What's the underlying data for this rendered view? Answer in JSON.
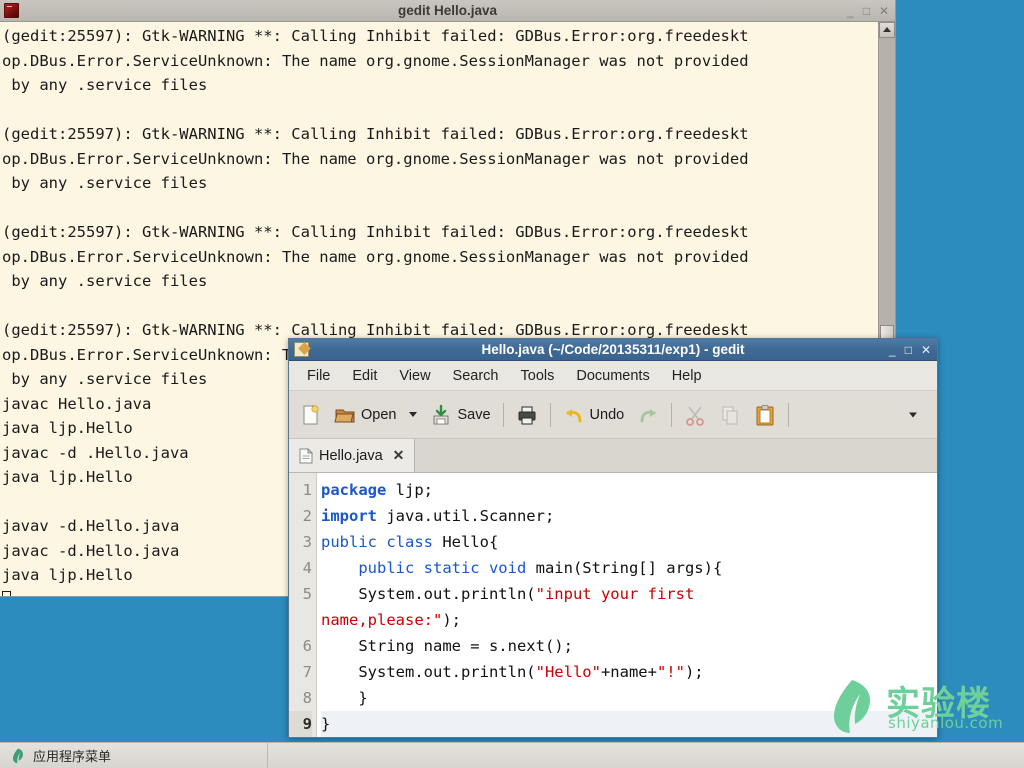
{
  "desktop": {
    "background_color": "#2c8cbd"
  },
  "terminal": {
    "title": "gedit Hello.java",
    "icon": "terminal-icon",
    "window_buttons": [
      {
        "name": "minimize-button",
        "glyph": "_"
      },
      {
        "name": "maximize-button",
        "glyph": "□"
      },
      {
        "name": "close-button",
        "glyph": "✕"
      }
    ],
    "background_color": "#fdf6e3",
    "lines": [
      "(gedit:25597): Gtk-WARNING **: Calling Inhibit failed: GDBus.Error:org.freedeskt",
      "op.DBus.Error.ServiceUnknown: The name org.gnome.SessionManager was not provided",
      " by any .service files",
      "",
      "(gedit:25597): Gtk-WARNING **: Calling Inhibit failed: GDBus.Error:org.freedeskt",
      "op.DBus.Error.ServiceUnknown: The name org.gnome.SessionManager was not provided",
      " by any .service files",
      "",
      "(gedit:25597): Gtk-WARNING **: Calling Inhibit failed: GDBus.Error:org.freedeskt",
      "op.DBus.Error.ServiceUnknown: The name org.gnome.SessionManager was not provided",
      " by any .service files",
      "",
      "(gedit:25597): Gtk-WARNING **: Calling Inhibit failed: GDBus.Error:org.freedeskt",
      "op.DBus.Error.ServiceUnknown: The name org.gnome.SessionManager was not provided",
      " by any .service files",
      "javac Hello.java",
      "java ljp.Hello",
      "javac -d .Hello.java",
      "java ljp.Hello",
      "",
      "javav -d.Hello.java",
      "javac -d.Hello.java",
      "java ljp.Hello"
    ]
  },
  "gedit": {
    "title": "Hello.java (~/Code/20135311/exp1) - gedit",
    "icon": "gedit-icon",
    "window_buttons": [
      {
        "name": "minimize-button",
        "glyph": "_"
      },
      {
        "name": "maximize-button",
        "glyph": "□"
      },
      {
        "name": "close-button",
        "glyph": "✕"
      }
    ],
    "menubar": [
      "File",
      "Edit",
      "View",
      "Search",
      "Tools",
      "Documents",
      "Help"
    ],
    "toolbar": {
      "new_label": "",
      "open_label": "Open",
      "save_label": "Save",
      "print_label": "",
      "undo_label": "Undo",
      "redo_label": "",
      "cut_label": "",
      "copy_label": "",
      "paste_label": ""
    },
    "tab": {
      "label": "Hello.java",
      "close_glyph": "✕"
    },
    "code": {
      "current_line": 9,
      "lines": [
        {
          "num": "1",
          "tokens": [
            {
              "t": "package",
              "c": "kw"
            },
            {
              "t": " ljp;",
              "c": "plain"
            }
          ]
        },
        {
          "num": "2",
          "tokens": [
            {
              "t": "import",
              "c": "kw"
            },
            {
              "t": " java.util.Scanner;",
              "c": "plain"
            }
          ]
        },
        {
          "num": "3",
          "tokens": [
            {
              "t": "public class",
              "c": "kw2"
            },
            {
              "t": " Hello{",
              "c": "plain"
            }
          ]
        },
        {
          "num": "4",
          "tokens": [
            {
              "t": "    ",
              "c": "plain"
            },
            {
              "t": "public static void",
              "c": "kw2"
            },
            {
              "t": " main(String[] args){",
              "c": "plain"
            }
          ]
        },
        {
          "num": "5",
          "tokens": [
            {
              "t": "    System.out.println(",
              "c": "plain"
            },
            {
              "t": "\"input your first",
              "c": "str"
            }
          ]
        },
        {
          "num": "",
          "tokens": [
            {
              "t": "name,please:\"",
              "c": "str"
            },
            {
              "t": ");",
              "c": "plain"
            }
          ]
        },
        {
          "num": "6",
          "tokens": [
            {
              "t": "    String name = s.next();",
              "c": "plain"
            }
          ]
        },
        {
          "num": "7",
          "tokens": [
            {
              "t": "    System.out.println(",
              "c": "plain"
            },
            {
              "t": "\"Hello\"",
              "c": "str"
            },
            {
              "t": "+name+",
              "c": "plain"
            },
            {
              "t": "\"!\"",
              "c": "str"
            },
            {
              "t": ");",
              "c": "plain"
            }
          ]
        },
        {
          "num": "8",
          "tokens": [
            {
              "t": "    }",
              "c": "plain"
            }
          ]
        },
        {
          "num": "9",
          "tokens": [
            {
              "t": "}",
              "c": "plain"
            }
          ]
        }
      ]
    }
  },
  "taskbar": {
    "app_menu_label": "应用程序菜单",
    "app_menu_icon": "shiyanlou-logo-icon"
  },
  "watermark": {
    "cn_text": "实验楼",
    "en_text": "shiyanlou.com",
    "color": "#6ecf9a"
  }
}
